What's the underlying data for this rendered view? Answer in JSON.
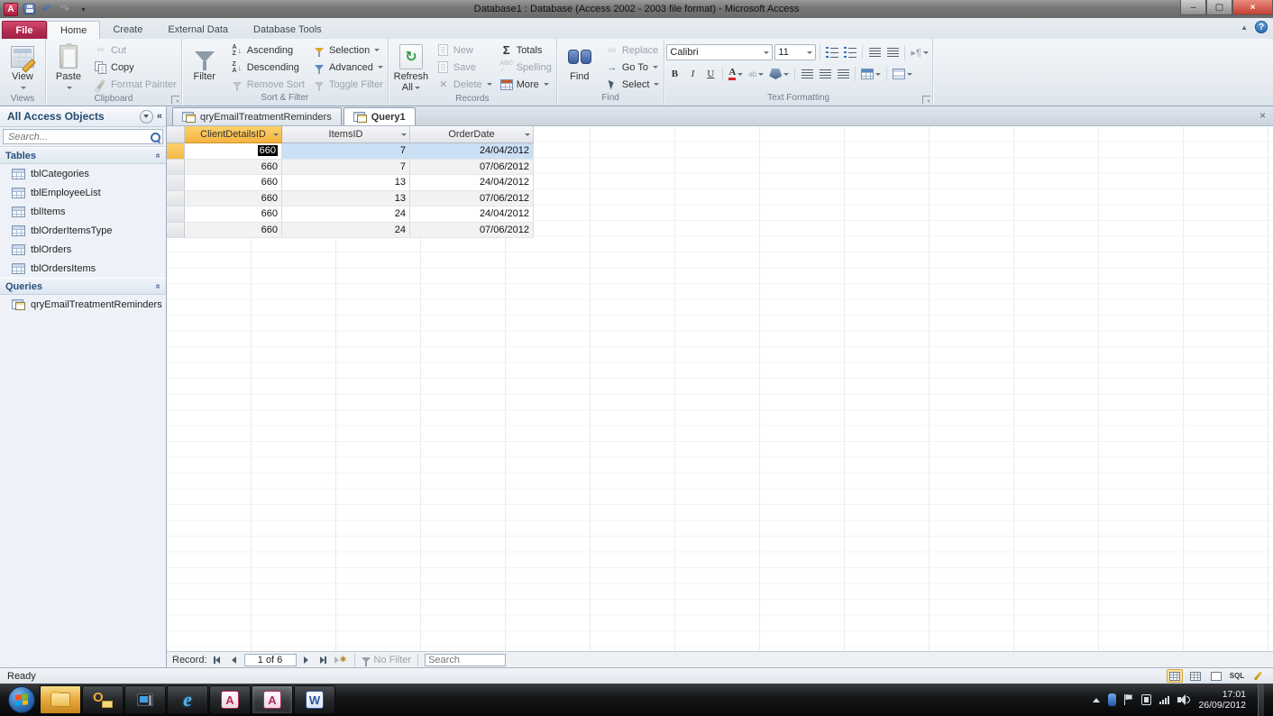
{
  "window": {
    "title": "Database1 : Database (Access 2002 - 2003 file format)  -  Microsoft Access"
  },
  "ribbon": {
    "tabs": {
      "file": "File",
      "home": "Home",
      "create": "Create",
      "external": "External Data",
      "dbtools": "Database Tools"
    },
    "views": {
      "label": "Views",
      "view": "View"
    },
    "clipboard": {
      "label": "Clipboard",
      "paste": "Paste",
      "cut": "Cut",
      "copy": "Copy",
      "format_painter": "Format Painter"
    },
    "sort_filter": {
      "label": "Sort & Filter",
      "filter": "Filter",
      "ascending": "Ascending",
      "descending": "Descending",
      "remove_sort": "Remove Sort",
      "selection": "Selection",
      "advanced": "Advanced",
      "toggle_filter": "Toggle Filter"
    },
    "records": {
      "label": "Records",
      "refresh1": "Refresh",
      "refresh2": "All",
      "new": "New",
      "save": "Save",
      "delete": "Delete",
      "totals": "Totals",
      "spelling": "Spelling",
      "more": "More"
    },
    "find": {
      "label": "Find",
      "find": "Find",
      "replace": "Replace",
      "goto": "Go To",
      "select": "Select"
    },
    "text_formatting": {
      "label": "Text Formatting",
      "font": "Calibri",
      "size": "11"
    }
  },
  "sidebar": {
    "title": "All Access Objects",
    "search_placeholder": "Search...",
    "tables_header": "Tables",
    "tables": [
      "tblCategories",
      "tblEmployeeList",
      "tblItems",
      "tblOrderItemsType",
      "tblOrders",
      "tblOrdersItems"
    ],
    "queries_header": "Queries",
    "queries": [
      "qryEmailTreatmentReminders"
    ]
  },
  "doc": {
    "tabs": [
      {
        "label": "qryEmailTreatmentReminders"
      },
      {
        "label": "Query1"
      }
    ],
    "columns": [
      "ClientDetailsID",
      "ItemsID",
      "OrderDate"
    ],
    "rows": [
      {
        "client": "660",
        "item": "7",
        "date": "24/04/2012"
      },
      {
        "client": "660",
        "item": "7",
        "date": "07/06/2012"
      },
      {
        "client": "660",
        "item": "13",
        "date": "24/04/2012"
      },
      {
        "client": "660",
        "item": "13",
        "date": "07/06/2012"
      },
      {
        "client": "660",
        "item": "24",
        "date": "24/04/2012"
      },
      {
        "client": "660",
        "item": "24",
        "date": "07/06/2012"
      }
    ],
    "recordnav": {
      "record_label": "Record:",
      "position": "1 of 6",
      "no_filter": "No Filter",
      "search_placeholder": "Search"
    }
  },
  "statusbar": {
    "ready": "Ready"
  },
  "taskbar": {
    "clock_time": "17:01",
    "clock_date": "26/09/2012"
  },
  "icons": {
    "access_a": "A",
    "word_w": "W",
    "ie_e": "e",
    "outlook_o": "O",
    "question": "?",
    "close": "×",
    "tab_close": "×",
    "chevron": "«",
    "collapse": "«",
    "sigma": "Σ",
    "scissors": "✂",
    "sort_a": "A",
    "sort_z": "Z",
    "arrow_down": "↓",
    "bold": "B",
    "italic": "I",
    "underline": "U",
    "font_a": "A",
    "abc": "ab",
    "paragraph": "¶",
    "sql": "SQL",
    "refresh": "↻",
    "goto_arrow": "→",
    "minimize": "–",
    "maximize": "▢",
    "win_close": "×",
    "undo": "↶",
    "redo": "↷"
  },
  "colors": {
    "file_tab": "#b02a4e",
    "header_highlight": "#f5b340",
    "selection_blue": "#cbdff5",
    "taskbar_black": "#111315"
  }
}
